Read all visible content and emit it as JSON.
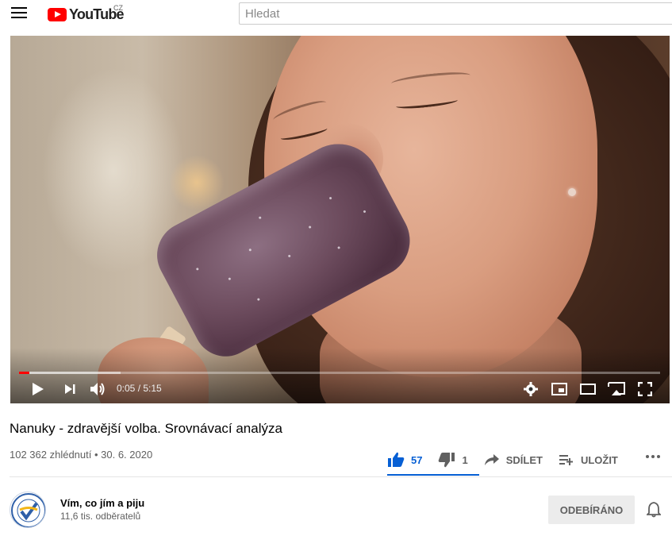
{
  "masthead": {
    "logo_text": "YouTube",
    "country_code": "CZ",
    "search_placeholder": "Hledat"
  },
  "player": {
    "current_time": "0:05",
    "duration": "5:15",
    "time_display": "0:05 / 5:15",
    "progress_fraction": 0.016,
    "buffered_fraction": 0.158
  },
  "video": {
    "title": "Nanuky - zdravější volba. Srovnávací analýza",
    "views": "102 362 zhlédnutí",
    "date": "30. 6. 2020",
    "meta_line": "102 362 zhlédnutí • 30. 6. 2020",
    "likes": "57",
    "dislikes": "1",
    "share_label": "SDÍLET",
    "save_label": "ULOŽIT"
  },
  "channel": {
    "name": "Vím, co jím a piju",
    "subscribers": "11,6 tis. odběratelů",
    "subscribe_label": "ODEBÍRÁNO"
  },
  "colors": {
    "accent_red": "#ff0000",
    "like_blue": "#065fd4"
  },
  "icons": [
    "menu-icon",
    "play-icon",
    "next-icon",
    "volume-icon",
    "settings-icon",
    "miniplayer-icon",
    "theater-icon",
    "cast-icon",
    "fullscreen-icon",
    "thumbs-up-icon",
    "thumbs-down-icon",
    "share-icon",
    "save-playlist-icon",
    "more-icon",
    "bell-icon"
  ]
}
